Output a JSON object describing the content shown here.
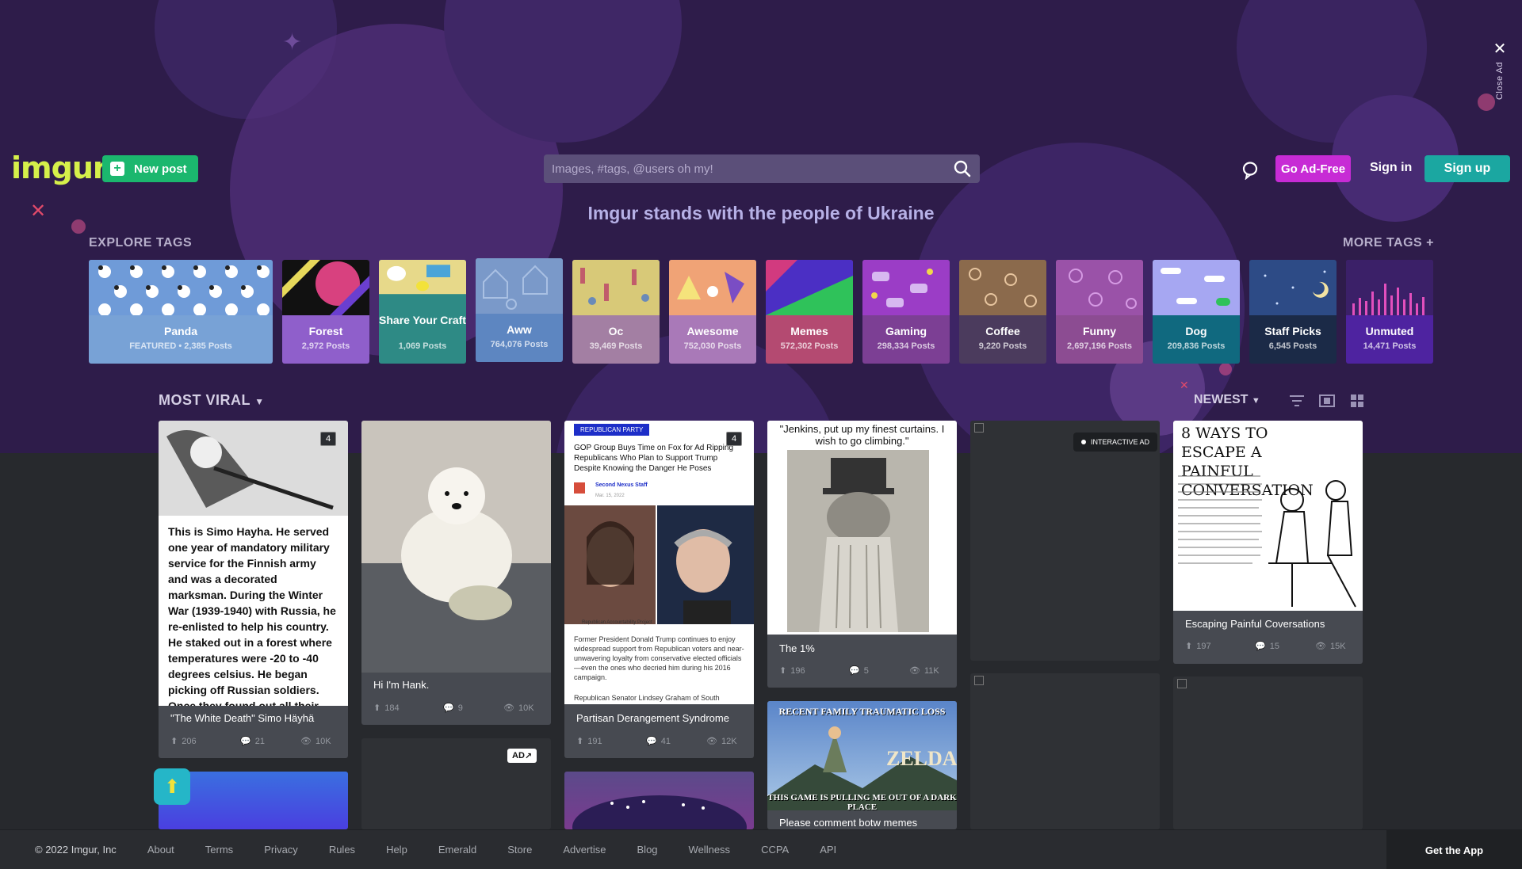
{
  "header": {
    "logo": "imgur",
    "new_post_label": "New post",
    "search_placeholder": "Images, #tags, @users oh my!",
    "go_ad_free_label": "Go Ad-Free",
    "sign_in_label": "Sign in",
    "sign_up_label": "Sign up",
    "close_ad_label": "Close Ad"
  },
  "banner": {
    "text": "Imgur stands with the people of Ukraine"
  },
  "explore": {
    "label": "EXPLORE TAGS",
    "more_label": "MORE TAGS +",
    "tags": [
      {
        "name": "Panda",
        "count": "FEATURED • 2,385 Posts",
        "color": "#78a2d6"
      },
      {
        "name": "Forest",
        "count": "2,972 Posts",
        "color": "#8f5fcb"
      },
      {
        "name": "Share Your Craft",
        "count": "1,069 Posts",
        "color": "#2e8a85"
      },
      {
        "name": "Aww",
        "count": "764,076 Posts",
        "color": "#5d86c1"
      },
      {
        "name": "Oc",
        "count": "39,469 Posts",
        "color": "#a37fa3"
      },
      {
        "name": "Awesome",
        "count": "752,030 Posts",
        "color": "#a979b8"
      },
      {
        "name": "Memes",
        "count": "572,302 Posts",
        "color": "#b44a71"
      },
      {
        "name": "Gaming",
        "count": "298,334 Posts",
        "color": "#7c3f94"
      },
      {
        "name": "Coffee",
        "count": "9,220 Posts",
        "color": "#4b3b5d"
      },
      {
        "name": "Funny",
        "count": "2,697,196 Posts",
        "color": "#8c4c92"
      },
      {
        "name": "Dog",
        "count": "209,836 Posts",
        "color": "#10697f"
      },
      {
        "name": "Staff Picks",
        "count": "6,545 Posts",
        "color": "#1b2a47"
      },
      {
        "name": "Unmuted",
        "count": "14,471 Posts",
        "color": "#4e23a0"
      }
    ]
  },
  "feed": {
    "sort_label": "MOST VIRAL",
    "order_label": "NEWEST",
    "posts": [
      {
        "title": "\"The White Death\" Simo Häyhä",
        "ups": "206",
        "comments": "21",
        "views": "10K",
        "badge": "4",
        "text": "This is Simo Hayha. He served one year of mandatory military service for the Finnish army and was a decorated marksman. During the Winter War (1939-1940) with Russia, he re-enlisted to help his country. He staked out in a forest where temperatures were -20 to -40 degrees celsius. He began picking off Russian soldiers. Once they found out all their"
      },
      {
        "title": "Hi I'm Hank.",
        "ups": "184",
        "comments": "9",
        "views": "10K"
      },
      {
        "title": "Partisan Derangement Syndrome",
        "ups": "191",
        "comments": "41",
        "views": "12K",
        "badge": "4",
        "article_tag": "REPUBLICAN PARTY",
        "headline": "GOP Group Buys Time on Fox for Ad Ripping Republicans Who Plan to Support Trump Despite Knowing the Danger He Poses",
        "author": "Second Nexus Staff",
        "date": "Mar. 15, 2022",
        "caption": "Republican Accountability Project",
        "body": "Former President Donald Trump continues to enjoy widespread support from Republican voters and near-unwavering loyalty from conservative elected officials—even the ones who decried him during his 2016 campaign.",
        "body2": "Republican Senator Lindsey Graham of South"
      },
      {
        "title": "The 1%",
        "ups": "196",
        "comments": "5",
        "views": "11K",
        "caption": "\"Jenkins, put up my finest curtains. I wish to go climbing.\""
      },
      {
        "title": "Escaping Painful Coversations",
        "ups": "197",
        "comments": "15",
        "views": "15K",
        "comic_title": "8 WAYS TO ESCAPE A PAINFUL CONVERSATION"
      },
      {
        "title": "Please comment botw memes",
        "top_text": "RECENT FAMILY TRAUMATIC LOSS",
        "bottom_text": "THIS GAME IS PULLING ME OUT OF A DARK PLACE",
        "logo_text": "ZELDA"
      }
    ],
    "interactive_ad_label": "INTERACTIVE AD",
    "ad_label": "AD"
  },
  "footer": {
    "copyright": "© 2022 Imgur, Inc",
    "links": [
      "About",
      "Terms",
      "Privacy",
      "Rules",
      "Help",
      "Emerald",
      "Store",
      "Advertise",
      "Blog",
      "Wellness",
      "CCPA",
      "API"
    ],
    "get_app": "Get the App"
  }
}
